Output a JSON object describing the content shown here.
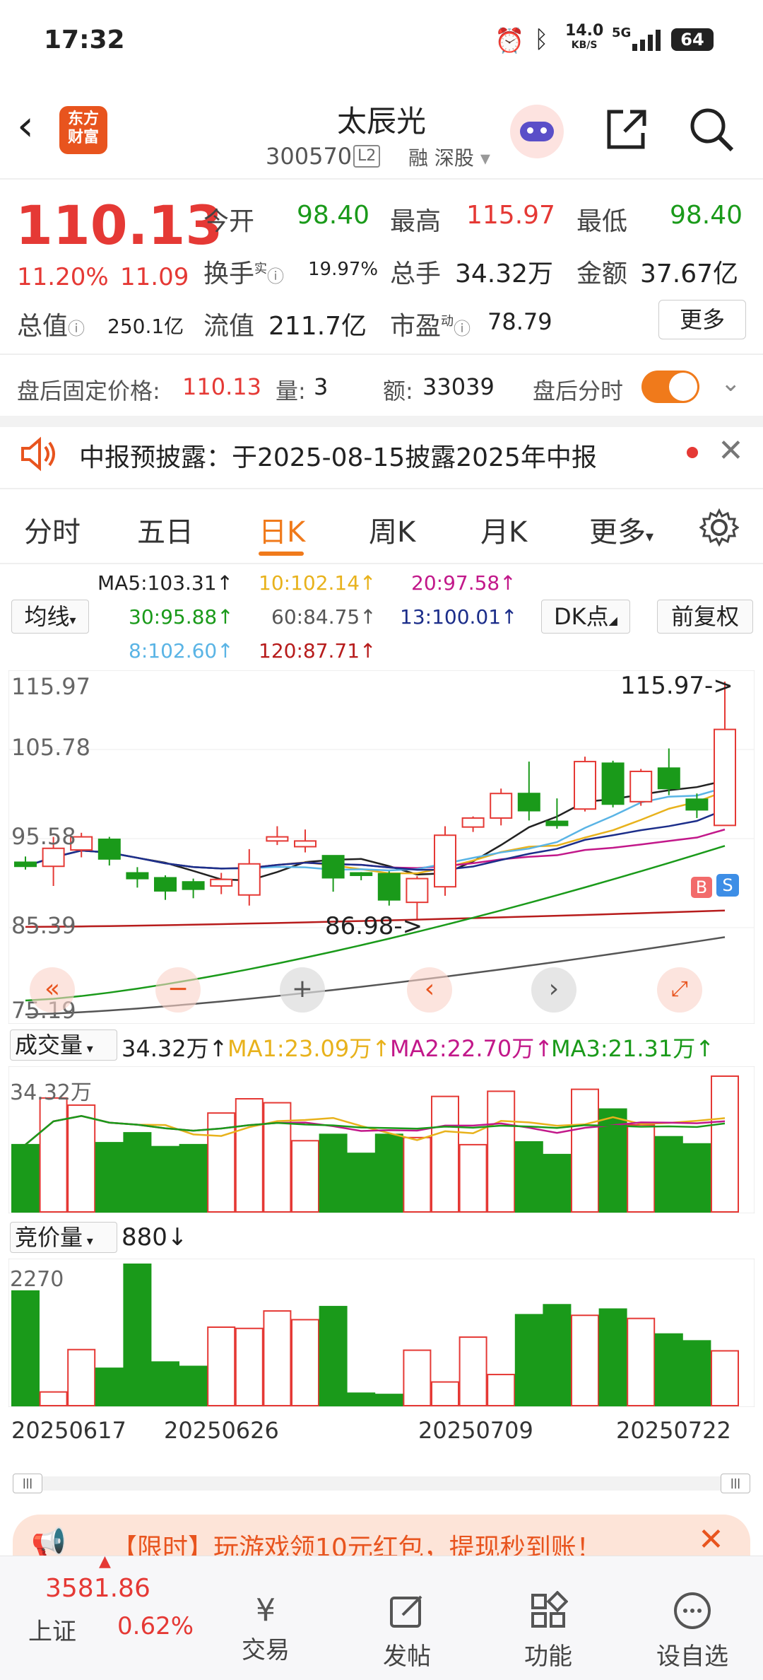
{
  "status_bar": {
    "time": "17:32",
    "net_speed_top": "14.0",
    "net_speed_bottom": "KB/S",
    "signal": "5G",
    "battery": "64"
  },
  "header": {
    "title": "太辰光",
    "code": "300570",
    "level_badge": "L2",
    "tags": "融 深股",
    "logo_line1": "东方",
    "logo_line2": "财富"
  },
  "quote": {
    "price": "110.13",
    "change_pct": "11.20%",
    "change": "11.09",
    "open_label": "今开",
    "open": "98.40",
    "high_label": "最高",
    "high": "115.97",
    "low_label": "最低",
    "low": "98.40",
    "turnover_label": "换手",
    "turnover_sup": "实",
    "turnover": "19.97%",
    "volume_label": "总手",
    "volume": "34.32万",
    "amount_label": "金额",
    "amount": "37.67亿",
    "mcap_label": "总值",
    "mcap": "250.1亿",
    "float_label": "流值",
    "float": "211.7亿",
    "pe_label": "市盈",
    "pe_sup": "动",
    "pe": "78.79",
    "more": "更多"
  },
  "after_hours": {
    "price_label": "盘后固定价格:",
    "price": "110.13",
    "vol_label": "量:",
    "vol": "3",
    "amt_label": "额:",
    "amt": "33039",
    "toggle_label": "盘后分时"
  },
  "notice": {
    "text": "中报预披露：于2025-08-15披露2025年中报"
  },
  "tabs": [
    {
      "label": "分时"
    },
    {
      "label": "五日"
    },
    {
      "label": "日K"
    },
    {
      "label": "周K"
    },
    {
      "label": "月K"
    },
    {
      "label": "更多"
    }
  ],
  "ma_legend": {
    "ma5": "MA5:103.31↑",
    "ma10": "10:102.14↑",
    "ma20": "20:97.58↑",
    "ma30": "30:95.88↑",
    "ma60": "60:84.75↑",
    "ma13": "13:100.01↑",
    "ma8": "8:102.60↑",
    "ma120": "120:87.71↑",
    "type_btn": "均线",
    "dk_btn": "DK点",
    "adjust_btn": "前复权"
  },
  "kchart_labels": {
    "y_max": "115.97",
    "y2": "105.78",
    "y3": "95.58",
    "y4": "85.39",
    "y_min": "75.19",
    "high_marker": "115.97->",
    "low_marker": "86.98->",
    "b_marker": "B",
    "s_marker": "S"
  },
  "volume_panel": {
    "label": "成交量",
    "value": "34.32万↑",
    "ma1": "MA1:23.09万↑",
    "ma2": "MA2:22.70万↑",
    "ma3": "MA3:21.31万↑",
    "y_max": "34.32万"
  },
  "auction_panel": {
    "label": "竞价量",
    "value": "880↓",
    "y_max": "2270"
  },
  "x_dates": [
    "20250617",
    "20250626",
    "20250709",
    "20250722"
  ],
  "ad_banner": {
    "text": "【限时】玩游戏领10元红包，提现秒到账！"
  },
  "bottom_nav": {
    "index_value": "3581.86",
    "index_name": "上证",
    "index_change": "0.62%",
    "items": [
      {
        "label": "交易"
      },
      {
        "label": "发帖"
      },
      {
        "label": "功能"
      },
      {
        "label": "设自选"
      }
    ]
  },
  "colors": {
    "up": "#e53935",
    "down": "#1a9a1a",
    "accent": "#f07a1b"
  },
  "chart_data": {
    "type": "candlestick",
    "dates_shown": [
      "20250617",
      "20250626",
      "20250709",
      "20250722"
    ],
    "ylim": [
      75.19,
      115.97
    ],
    "candles": [
      {
        "o": 93.9,
        "h": 94.6,
        "c": 93.4,
        "l": 93.0
      },
      {
        "o": 93.4,
        "h": 97.0,
        "c": 95.6,
        "l": 91.0
      },
      {
        "o": 95.4,
        "h": 97.5,
        "c": 97.0,
        "l": 94.5
      },
      {
        "o": 96.7,
        "h": 97.0,
        "c": 94.3,
        "l": 93.5
      },
      {
        "o": 92.6,
        "h": 93.3,
        "c": 91.9,
        "l": 90.8
      },
      {
        "o": 92.0,
        "h": 92.3,
        "c": 90.4,
        "l": 89.3
      },
      {
        "o": 91.5,
        "h": 91.9,
        "c": 90.6,
        "l": 89.5
      },
      {
        "o": 91.0,
        "h": 92.6,
        "c": 91.8,
        "l": 90.0
      },
      {
        "o": 89.9,
        "h": 95.5,
        "c": 93.7,
        "l": 88.6
      },
      {
        "o": 96.5,
        "h": 98.3,
        "c": 97.0,
        "l": 96.0
      },
      {
        "o": 95.8,
        "h": 97.9,
        "c": 96.5,
        "l": 95.1
      },
      {
        "o": 94.7,
        "h": 94.7,
        "c": 92.0,
        "l": 90.3
      },
      {
        "o": 92.6,
        "h": 92.7,
        "c": 92.3,
        "l": 91.7
      },
      {
        "o": 92.5,
        "h": 92.8,
        "c": 89.3,
        "l": 88.6
      },
      {
        "o": 89.0,
        "h": 92.2,
        "c": 91.9,
        "l": 86.98
      },
      {
        "o": 90.9,
        "h": 98.3,
        "c": 97.2,
        "l": 89.8
      },
      {
        "o": 98.2,
        "h": 99.5,
        "c": 99.3,
        "l": 97.6
      },
      {
        "o": 99.3,
        "h": 102.9,
        "c": 102.3,
        "l": 98.4
      },
      {
        "o": 102.3,
        "h": 106.2,
        "c": 100.2,
        "l": 99.0
      },
      {
        "o": 98.9,
        "h": 101.7,
        "c": 98.4,
        "l": 98.0
      },
      {
        "o": 100.4,
        "h": 106.8,
        "c": 106.2,
        "l": 100.1
      },
      {
        "o": 106.0,
        "h": 106.3,
        "c": 101.0,
        "l": 100.6
      },
      {
        "o": 101.3,
        "h": 105.3,
        "c": 105.0,
        "l": 100.8
      },
      {
        "o": 105.4,
        "h": 107.8,
        "c": 102.9,
        "l": 102.1
      },
      {
        "o": 101.6,
        "h": 102.3,
        "c": 100.3,
        "l": 99.3
      },
      {
        "o": 98.4,
        "h": 115.97,
        "c": 110.13,
        "l": 98.4
      }
    ],
    "volumes": [
      17.0,
      28.8,
      27.0,
      17.5,
      20.0,
      16.5,
      17.0,
      25.0,
      28.6,
      27.6,
      18.0,
      19.6,
      14.8,
      19.6,
      18.8,
      29.2,
      17.0,
      30.5,
      17.7,
      14.5,
      31.0,
      26.0,
      22.0,
      19.0,
      17.2,
      34.32
    ],
    "auction": [
      1840,
      220,
      900,
      600,
      2270,
      700,
      630,
      1260,
      1240,
      1520,
      1380,
      1590,
      200,
      180,
      890,
      380,
      1100,
      500,
      1460,
      1620,
      1450,
      1550,
      1400,
      1150,
      1040,
      880
    ]
  }
}
